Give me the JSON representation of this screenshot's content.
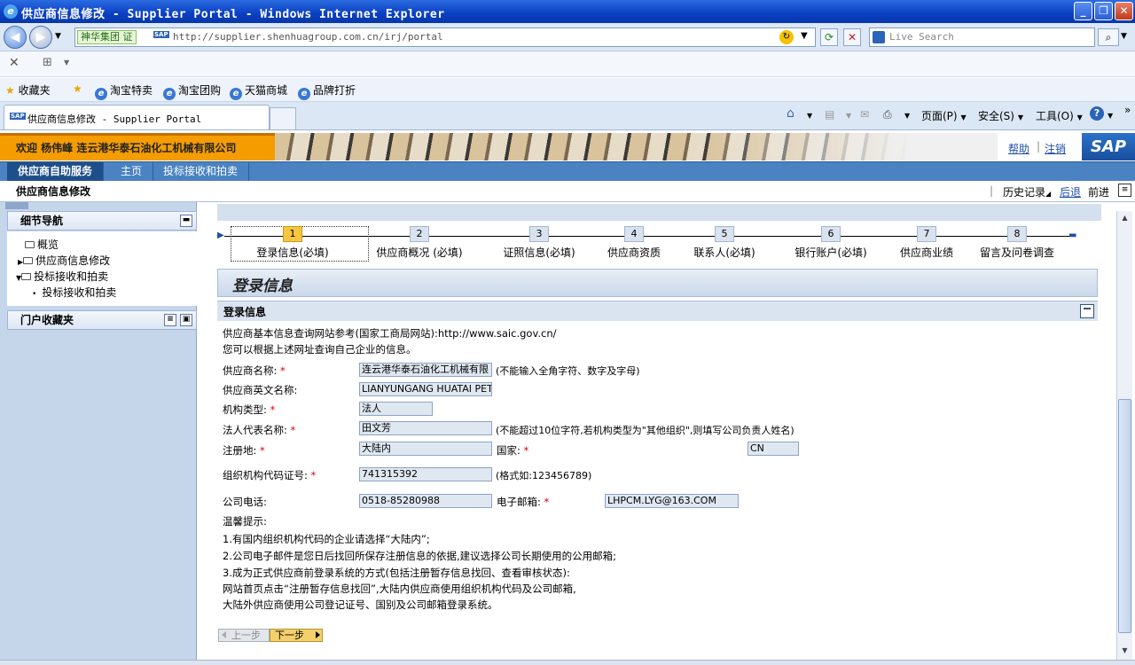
{
  "window": {
    "title": "供应商信息修改 - Supplier Portal - Windows Internet Explorer"
  },
  "addressbar": {
    "site_badge": "神华集团 证",
    "url": "http://supplier.shenhuagroup.com.cn/irj/portal",
    "search_placeholder": "Live Search"
  },
  "favorites": {
    "label": "收藏夹",
    "items": [
      "淘宝特卖",
      "淘宝团购",
      "天猫商城",
      "品牌打折"
    ]
  },
  "tabs": [
    {
      "label": "供应商信息修改 - Supplier Portal"
    }
  ],
  "toolbar": {
    "page": "页面(P)",
    "safety": "安全(S)",
    "tools": "工具(O)"
  },
  "portal": {
    "welcome": "欢迎 杨伟峰 连云港华泰石油化工机械有限公司",
    "help": "帮助",
    "logout": "注销",
    "logo": "SAP",
    "nav": [
      "供应商自助服务",
      "主页",
      "投标接收和拍卖"
    ],
    "page_title": "供应商信息修改",
    "history": "历史记录",
    "back": "后退",
    "forward": "前进"
  },
  "left_panel": {
    "detail_nav_title": "细节导航",
    "items": [
      {
        "label": "概览",
        "indent": 0,
        "expand": ""
      },
      {
        "label": "供应商信息修改",
        "indent": 0,
        "expand": "▶"
      },
      {
        "label": "投标接收和拍卖",
        "indent": 0,
        "expand": "▼"
      },
      {
        "label": "投标接收和拍卖",
        "indent": 1,
        "expand": "•"
      }
    ],
    "favorites_title": "门户收藏夹"
  },
  "roadmap": {
    "steps": [
      {
        "num": "1",
        "label": "登录信息(必填)",
        "current": true
      },
      {
        "num": "2",
        "label": "供应商概况 (必填)",
        "current": false
      },
      {
        "num": "3",
        "label": "证照信息(必填)",
        "current": false
      },
      {
        "num": "4",
        "label": "供应商资质",
        "current": false
      },
      {
        "num": "5",
        "label": "联系人(必填)",
        "current": false
      },
      {
        "num": "6",
        "label": "银行账户(必填)",
        "current": false
      },
      {
        "num": "7",
        "label": "供应商业绩",
        "current": false
      },
      {
        "num": "8",
        "label": "留言及问卷调查",
        "current": false
      }
    ]
  },
  "form": {
    "page_heading": "登录信息",
    "section_title": "登录信息",
    "intro1": "供应商基本信息查询网站参考(国家工商局网站):http://www.saic.gov.cn/",
    "intro2": "您可以根据上述网址查询自己企业的信息。",
    "fields": {
      "name_label": "供应商名称:",
      "name_value": "连云港华泰石油化工机械有限",
      "name_hint": "(不能输入全角字符、数字及字母)",
      "en_name_label": "供应商英文名称:",
      "en_name_value": "LIANYUNGANG HUATAI PETR",
      "org_type_label": "机构类型:",
      "org_type_value": "法人",
      "legal_rep_label": "法人代表名称:",
      "legal_rep_value": "田文芳",
      "legal_rep_hint": "(不能超过10位字符,若机构类型为\"其他组织\",则填写公司负责人姓名)",
      "reg_place_label": "注册地:",
      "reg_place_value": "大陆内",
      "country_label": "国家:",
      "country_value": "CN",
      "org_code_label": "组织机构代码证号:",
      "org_code_value": "741315392",
      "org_code_hint": "(格式如:123456789)",
      "phone_label": "公司电话:",
      "phone_value": "0518-85280988",
      "email_label": "电子邮箱:",
      "email_value": "LHPCM.LYG@163.COM"
    },
    "required_mark": "*",
    "tips_title": "温馨提示:",
    "tips": [
      "1.有国内组织机构代码的企业请选择“大陆内”;",
      "2.公司电子邮件是您日后找回所保存注册信息的依据,建议选择公司长期使用的公用邮箱;",
      "3.成为正式供应商前登录系统的方式(包括注册暂存信息找回、查看审核状态):",
      "网站首页点击“注册暂存信息找回”,大陆内供应商使用组织机构代码及公司邮箱,",
      "大陆外供应商使用公司登记证号、国别及公司邮箱登录系统。"
    ],
    "prev_button": "上一步",
    "next_button": "下一步"
  },
  "icons": {
    "back": "back-arrow-icon",
    "forward": "forward-arrow-icon",
    "refresh": "refresh-icon",
    "stop": "stop-icon",
    "search": "search-icon",
    "home": "home-icon",
    "feeds": "rss-icon",
    "mail": "mail-icon",
    "print": "print-icon",
    "help": "help-icon"
  }
}
